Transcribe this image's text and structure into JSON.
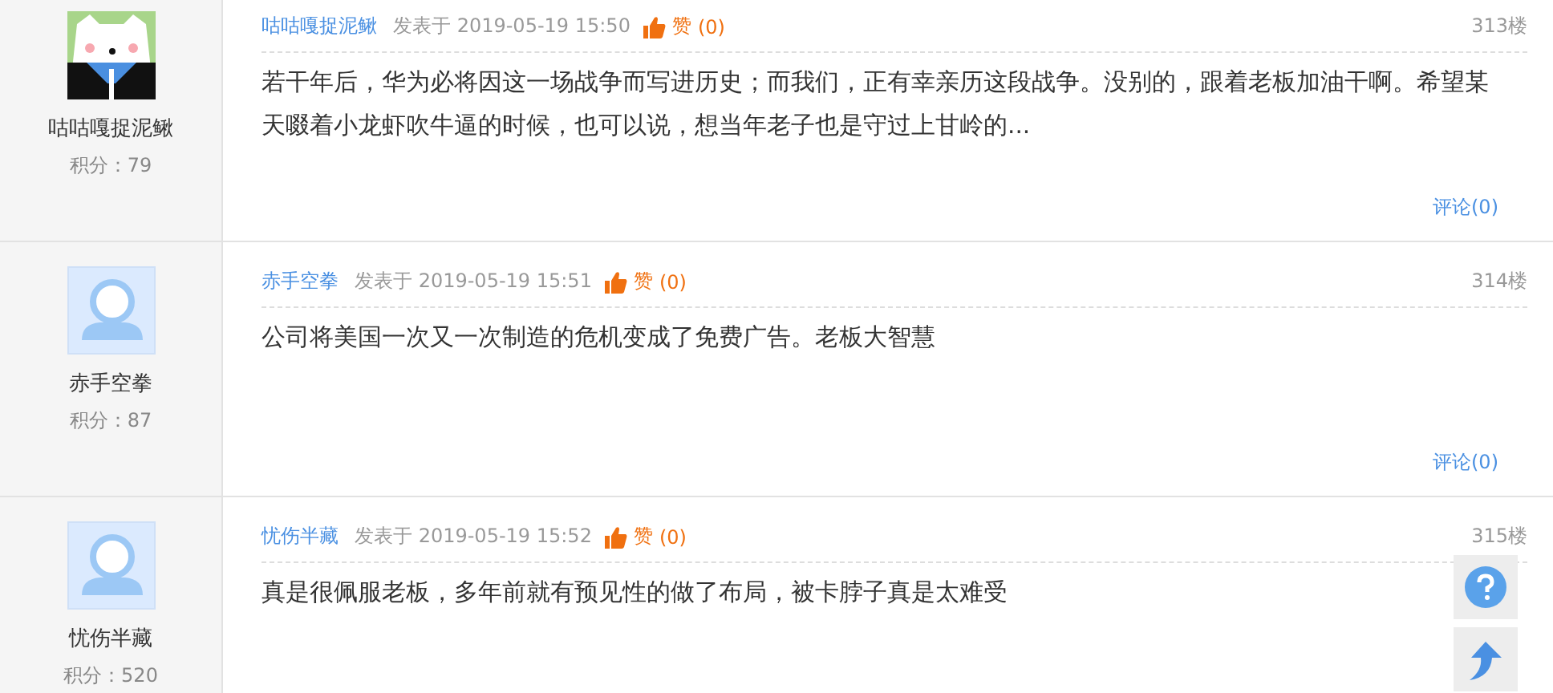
{
  "posts": [
    {
      "user_name": "咕咕嘎捉泥鳅",
      "author": "咕咕嘎捉泥鳅",
      "avatar": {
        "kind": "cartoon"
      },
      "score": "积分：79",
      "posted": "发表于 2019-05-19 15:50",
      "like_label": "赞",
      "like_count": "(0)",
      "floor": "313楼",
      "text": "若干年后，华为必将因这一场战争而写进历史；而我们，正有幸亲历这段战争。没别的，跟着老板加油干啊。希望某天啜着小龙虾吹牛逼的时候，也可以说，想当年老子也是守过上甘岭的...",
      "comment_link": "评论(0)"
    },
    {
      "user_name": "赤手空拳",
      "author": "赤手空拳",
      "avatar": {
        "kind": "default"
      },
      "score": "积分：87",
      "posted": "发表于 2019-05-19 15:51",
      "like_label": "赞",
      "like_count": "(0)",
      "floor": "314楼",
      "text": "公司将美国一次又一次制造的危机变成了免费广告。老板大智慧",
      "comment_link": "评论(0)"
    },
    {
      "user_name": "忧伤半藏",
      "author": "忧伤半藏",
      "avatar": {
        "kind": "default"
      },
      "score": "积分：520",
      "posted": "发表于 2019-05-19 15:52",
      "like_label": "赞",
      "like_count": "(0)",
      "floor": "315楼",
      "text": "真是很佩服老板，多年前就有预见性的做了布局，被卡脖子真是太难受"
    }
  ]
}
